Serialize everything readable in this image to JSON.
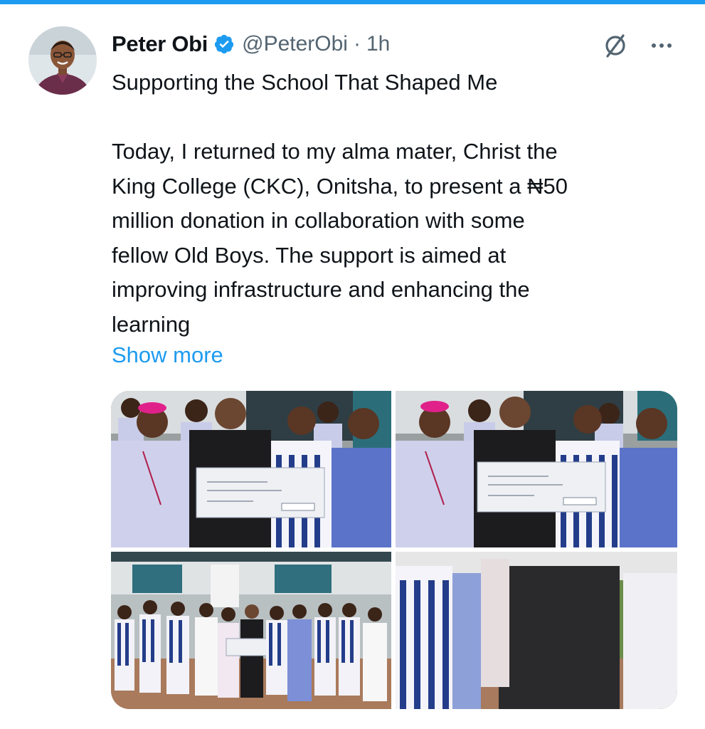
{
  "author": {
    "display_name": "Peter Obi",
    "handle": "@PeterObi",
    "separator": "·",
    "time": "1h",
    "verified_icon": "verified-badge-icon"
  },
  "actions": {
    "grok_icon": "grok-slash-icon",
    "more_icon": "more-horizontal-icon"
  },
  "tweet": {
    "text": "Supporting the School That Shaped Me\n\nToday, I returned to my alma mater, Christ the\nKing College (CKC), Onitsha, to present a ₦50\nmillion donation in collaboration with some\nfellow Old Boys. The support is aimed at\nimproving infrastructure and enhancing the\nlearning",
    "show_more": "Show more"
  },
  "media": {
    "cheque_amount": "50,000,000",
    "cheque_payee": "C.K.C Onitsha",
    "cheque_words": "Fifty Million Naira only"
  },
  "colors": {
    "accent": "#1d9bf0",
    "text": "#0f1419",
    "secondary": "#536471"
  }
}
